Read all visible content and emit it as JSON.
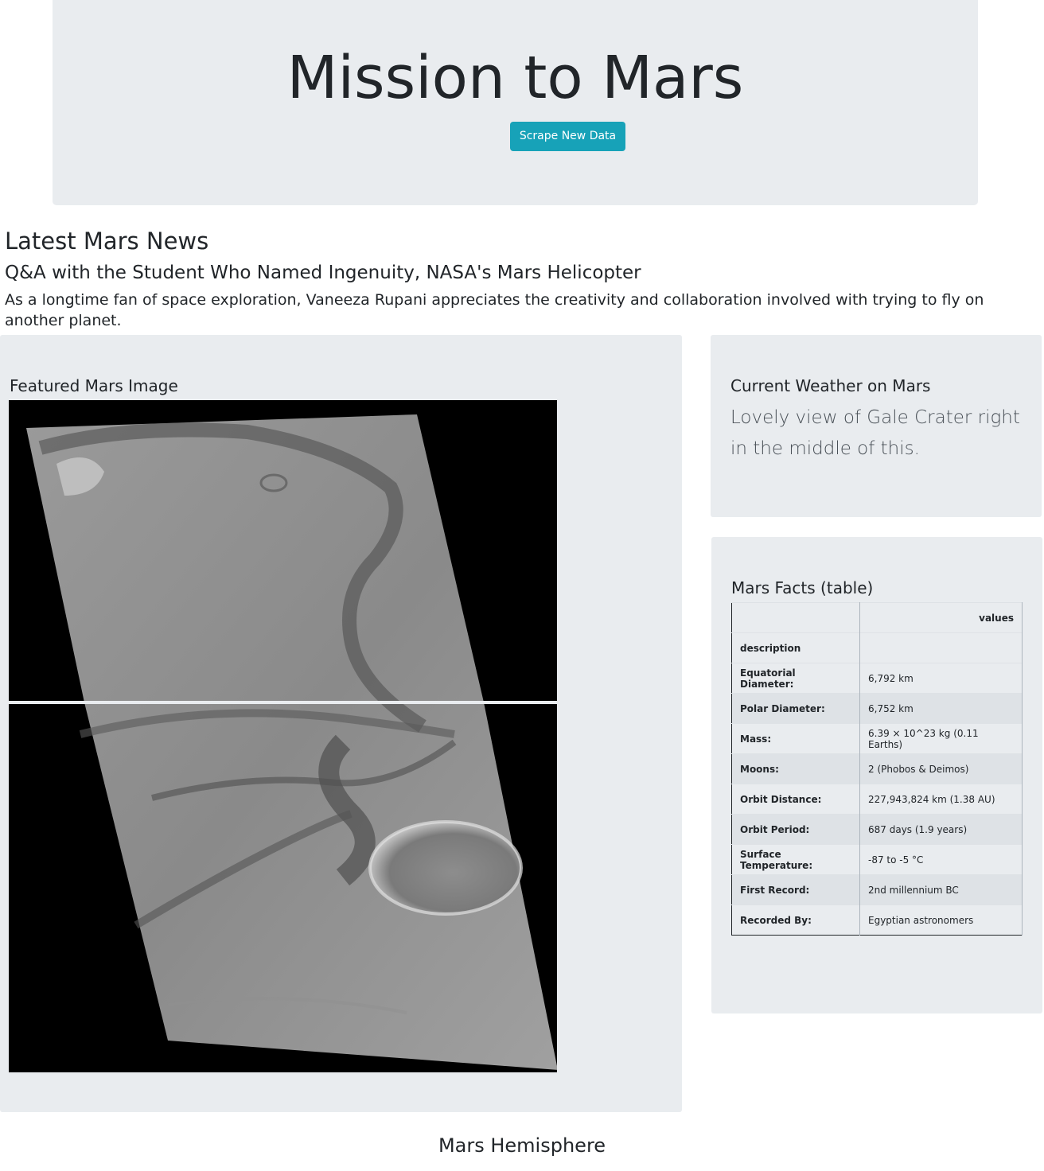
{
  "header": {
    "title": "Mission to Mars",
    "scrape_button_label": "Scrape New Data"
  },
  "news": {
    "section_title": "Latest Mars News",
    "headline": "Q&A with the Student Who Named Ingenuity, NASA's Mars Helicopter",
    "teaser": "As a longtime fan of space exploration, Vaneeza Rupani appreciates the creativity and collaboration involved with trying to fly on another planet."
  },
  "featured": {
    "heading": "Featured Mars Image"
  },
  "weather": {
    "heading": "Current Weather on Mars",
    "text": "Lovely view of Gale Crater right in the middle of this."
  },
  "facts": {
    "heading": "Mars Facts (table)",
    "column_header": "values",
    "index_label": "description",
    "rows": [
      {
        "label": "Equatorial Diameter:",
        "value": "6,792 km"
      },
      {
        "label": "Polar Diameter:",
        "value": "6,752 km"
      },
      {
        "label": "Mass:",
        "value": "6.39 × 10^23 kg (0.11 Earths)"
      },
      {
        "label": "Moons:",
        "value": "2 (Phobos & Deimos)"
      },
      {
        "label": "Orbit Distance:",
        "value": "227,943,824 km (1.38 AU)"
      },
      {
        "label": "Orbit Period:",
        "value": "687 days (1.9 years)"
      },
      {
        "label": "Surface Temperature:",
        "value": "-87 to -5 °C"
      },
      {
        "label": "First Record:",
        "value": "2nd millennium BC"
      },
      {
        "label": "Recorded By:",
        "value": "Egyptian astronomers"
      }
    ]
  },
  "hemispheres": {
    "heading": "Mars Hemisphere"
  }
}
